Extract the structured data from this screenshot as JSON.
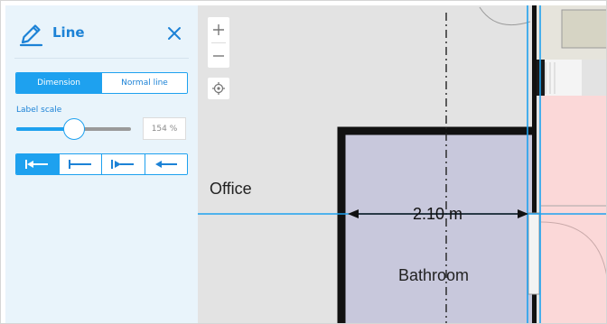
{
  "panel": {
    "title": "Line",
    "icon": "pencil-icon",
    "mode_tabs": [
      {
        "label": "Dimension",
        "active": true
      },
      {
        "label": "Normal line",
        "active": false
      }
    ],
    "label_scale": {
      "label": "Label scale",
      "value": "154 %",
      "level": 0.5
    },
    "arrow_styles": [
      {
        "icon": "arrow-bar-start-icon",
        "active": true
      },
      {
        "icon": "line-bar-start-icon",
        "active": false
      },
      {
        "icon": "arrow-bar-mid-icon",
        "active": false
      },
      {
        "icon": "arrow-left-icon",
        "active": false
      }
    ]
  },
  "map": {
    "controls": {
      "zoom_in": "+",
      "zoom_out": "–",
      "locate_icon": "crosshair-icon"
    },
    "rooms": [
      "Office",
      "Bathroom"
    ],
    "dimension": "2.10 m"
  },
  "colors": {
    "accent": "#1ea1ef",
    "bathroom_fill": "#c8c8dc",
    "pink_room_fill": "#fbd8d8",
    "floor_grey": "#e3e3e3"
  }
}
